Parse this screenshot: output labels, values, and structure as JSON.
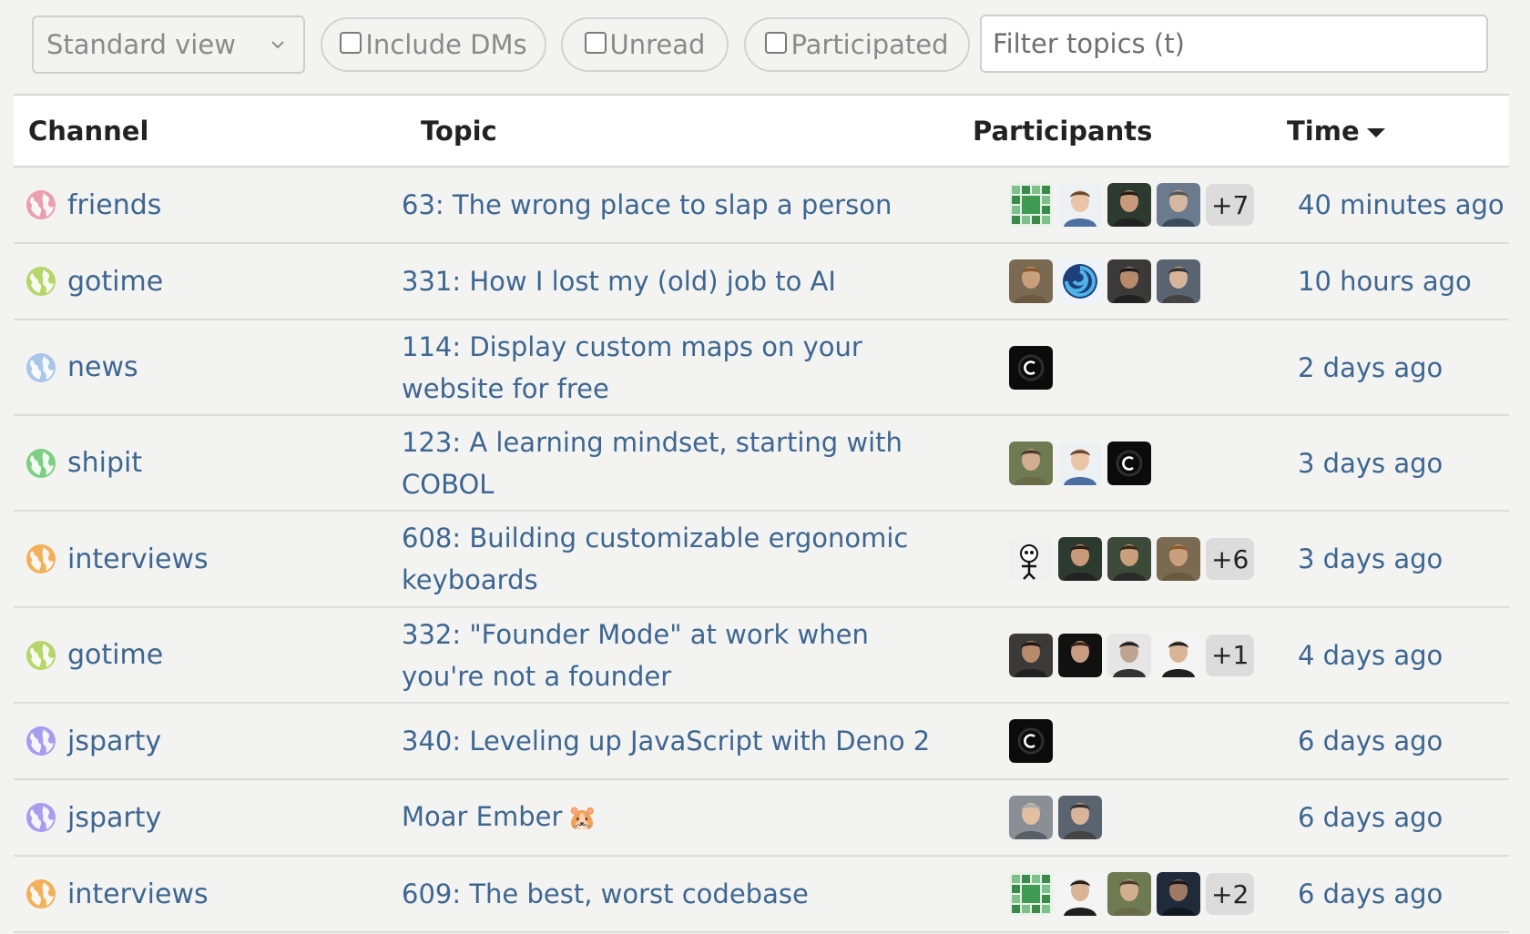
{
  "filters": {
    "view_select": "Standard view",
    "include_dms": "Include DMs",
    "unread": "Unread",
    "participated": "Participated",
    "search_placeholder": "Filter topics (t)"
  },
  "table": {
    "headers": {
      "channel": "Channel",
      "topic": "Topic",
      "participants": "Participants",
      "time": "Time"
    },
    "rows": [
      {
        "channel": "friends",
        "channel_color": "#e99fae",
        "topic": "63: The wrong place to slap a person",
        "more": "+7",
        "time": "40 minutes ago",
        "avatars": [
          "pattern-green",
          "person-light",
          "person-dark",
          "person-glasses"
        ]
      },
      {
        "channel": "gotime",
        "channel_color": "#b5d66a",
        "topic": "331: How I lost my (old) job to AI",
        "more": "",
        "time": "10 hours ago",
        "avatars": [
          "person-curly",
          "swirl-logo",
          "person-bald",
          "person-gray"
        ]
      },
      {
        "channel": "news",
        "channel_color": "#a9c6ea",
        "topic": "114: Display custom maps on your website for free",
        "more": "",
        "time": "2 days ago",
        "avatars": [
          "changelog-logo"
        ]
      },
      {
        "channel": "shipit",
        "channel_color": "#7dcf84",
        "topic": "123: A learning mindset, starting with COBOL",
        "more": "",
        "time": "3 days ago",
        "avatars": [
          "person-photo",
          "person-light",
          "changelog-logo"
        ]
      },
      {
        "channel": "interviews",
        "channel_color": "#f2b05a",
        "topic": "608: Building customizable ergonomic keyboards",
        "more": "+6",
        "time": "3 days ago",
        "avatars": [
          "cartoon-logo",
          "person-dark",
          "person-beard",
          "person-curly"
        ]
      },
      {
        "channel": "gotime",
        "channel_color": "#b5d66a",
        "topic": "332: \"Founder Mode\" at work when you're not a founder",
        "more": "+1",
        "time": "4 days ago",
        "avatars": [
          "person-bald",
          "person-black",
          "person-bw",
          "person-thumbs"
        ]
      },
      {
        "channel": "jsparty",
        "channel_color": "#a79df0",
        "topic": "340: Leveling up JavaScript with Deno 2",
        "more": "",
        "time": "6 days ago",
        "avatars": [
          "changelog-logo"
        ]
      },
      {
        "channel": "jsparty",
        "channel_color": "#a79df0",
        "topic": "Moar Ember",
        "topic_emoji": "🐹",
        "more": "",
        "time": "6 days ago",
        "avatars": [
          "person-older",
          "person-gray"
        ]
      },
      {
        "channel": "interviews",
        "channel_color": "#f2b05a",
        "topic": "609: The best, worst codebase",
        "more": "+2",
        "time": "6 days ago",
        "avatars": [
          "pattern-green",
          "person-thumbs",
          "person-photo",
          "person-night"
        ]
      }
    ]
  }
}
